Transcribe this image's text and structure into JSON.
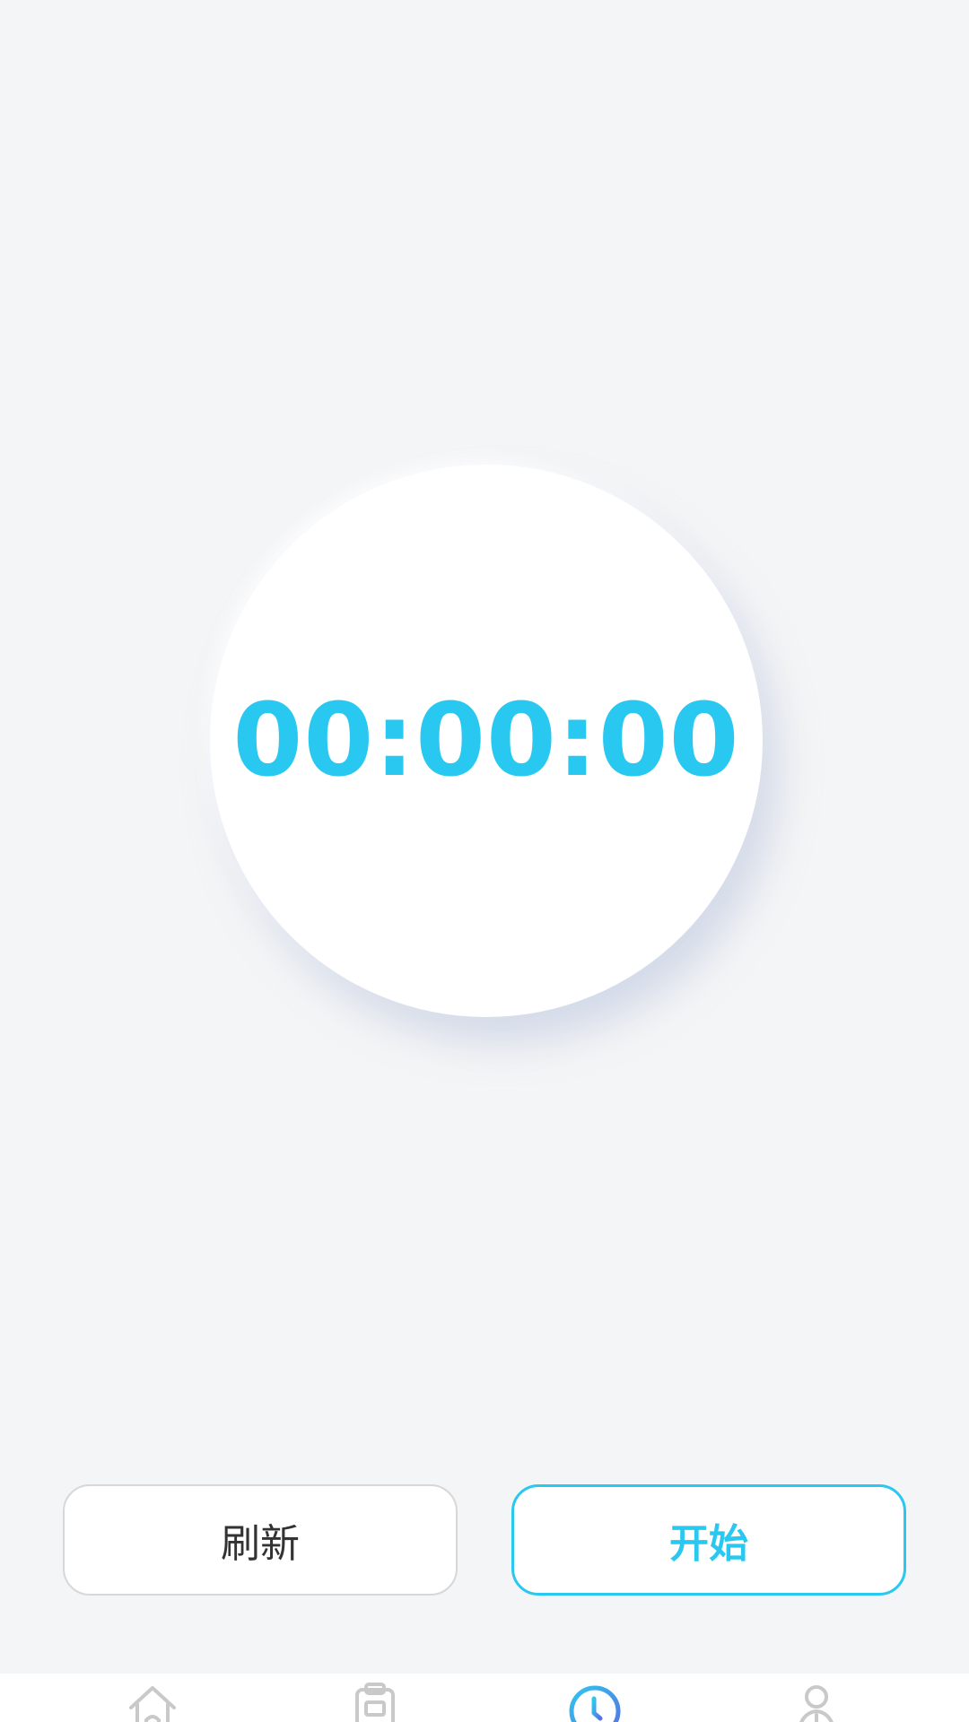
{
  "colors": {
    "accent": "#29c8f0",
    "active_tab": "#4b84e6",
    "inactive_tab": "#c9c9c9",
    "background": "#f4f5f6"
  },
  "timer": {
    "display": "00:00:00"
  },
  "buttons": {
    "refresh_label": "刷新",
    "start_label": "开始"
  },
  "tabbar": {
    "active_index": 2,
    "tabs": [
      {
        "icon": "home-icon"
      },
      {
        "icon": "clipboard-icon"
      },
      {
        "icon": "clock-icon"
      },
      {
        "icon": "user-icon"
      }
    ]
  }
}
